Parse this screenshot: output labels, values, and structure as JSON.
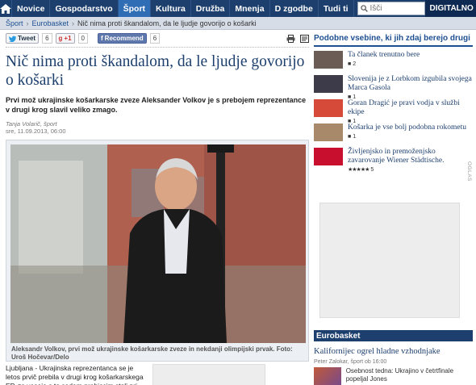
{
  "nav": {
    "items": [
      "Novice",
      "Gospodarstvo",
      "Šport",
      "Kultura",
      "Družba",
      "Mnenja",
      "D zgodbe",
      "Tudi ti"
    ],
    "active_index": 2,
    "search_placeholder": "Išči",
    "brand": "DIGITALNO"
  },
  "breadcrumb": {
    "items": [
      "Šport",
      "Eurobasket"
    ],
    "current": "Nič nima proti škandalom, da le ljudje govorijo o košarki"
  },
  "social": {
    "tweet": "Tweet",
    "tweet_count": "6",
    "gplus": "+1",
    "gplus_count": "0",
    "recommend": "Recommend",
    "recommend_count": "6"
  },
  "article": {
    "title": "Nič nima proti škandalom, da le ljudje govorijo o košarki",
    "lead": "Prvi mož ukrajinske košarkarske zveze Aleksander Volkov je s prebojem reprezentance v drugi krog slavil veliko zmago.",
    "author": "Tanja Volarič, šport",
    "date": "sre, 11.09.2013, 06:00",
    "caption": "Aleksandr Volkov, prvi mož ukrajinske košarkarske zveze in nekdanji olimpijski prvak. Foto: Uroš Hočevar/Delo",
    "body": "Ljubljana - Ukrajinska reprezentanca se je letos prvič prebila v drugi krog košarkarskega EP, za veseje s to sedem prebiscim stoli pri sam."
  },
  "related": {
    "heading": "Podobne vsebine, ki jih zdaj berejo drugi",
    "items": [
      {
        "title": "Ta članek trenutno bere",
        "count": "2",
        "thumb": "#6b5d55"
      },
      {
        "title": "Slovenija je z Lorbkom izgubila svojega Marca Gasola",
        "count": "1",
        "thumb": "#3d3a4a"
      },
      {
        "title": "Goran Dragić je pravi vodja v službi ekipe",
        "count": "1",
        "thumb": "#d64a3a"
      },
      {
        "title": "Košarka je vse bolj podobna rokometu",
        "count": "1",
        "thumb": "#a88a6a"
      },
      {
        "title": "Življenjsko in premoženjsko zavarovanje Wiener Städtische.",
        "count": "5",
        "thumb": "#c8102e"
      }
    ]
  },
  "ad_label": "OGLAS",
  "eurobasket": {
    "heading": "Eurobasket",
    "title": "Kalifornijec ogrel hladne vzhodnjake",
    "meta": "Peter Zalokar, šport  ob 16:00",
    "item_text": "Osebnost tedna: Ukrajino v četrtfinale popeljal Jones"
  },
  "colors": {
    "nav_bg": "#1d3f6e",
    "nav_active": "#2f6db5",
    "link": "#1d4f91"
  }
}
